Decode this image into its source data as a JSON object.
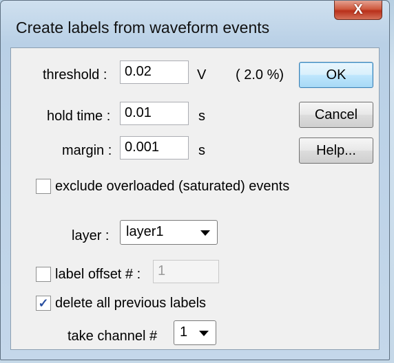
{
  "window": {
    "title": "Create labels from waveform events",
    "close_glyph": "X"
  },
  "threshold": {
    "label": "threshold :",
    "value": "0.02",
    "unit": "V",
    "percent": "( 2.0 %)"
  },
  "hold_time": {
    "label": "hold time :",
    "value": "0.01",
    "unit": "s"
  },
  "margin": {
    "label": "margin :",
    "value": "0.001",
    "unit": "s"
  },
  "buttons": {
    "ok": "OK",
    "cancel": "Cancel",
    "help": "Help..."
  },
  "exclude_overloaded": {
    "label": "exclude overloaded (saturated) events",
    "checked": false
  },
  "layer": {
    "label": "layer :",
    "selected": "layer1"
  },
  "label_offset": {
    "label": "label offset # :",
    "value": "1",
    "checked": false
  },
  "delete_previous": {
    "label": "delete all previous labels",
    "checked": true,
    "check_glyph": "✓"
  },
  "take_channel": {
    "label": "take channel #",
    "selected": "1"
  }
}
